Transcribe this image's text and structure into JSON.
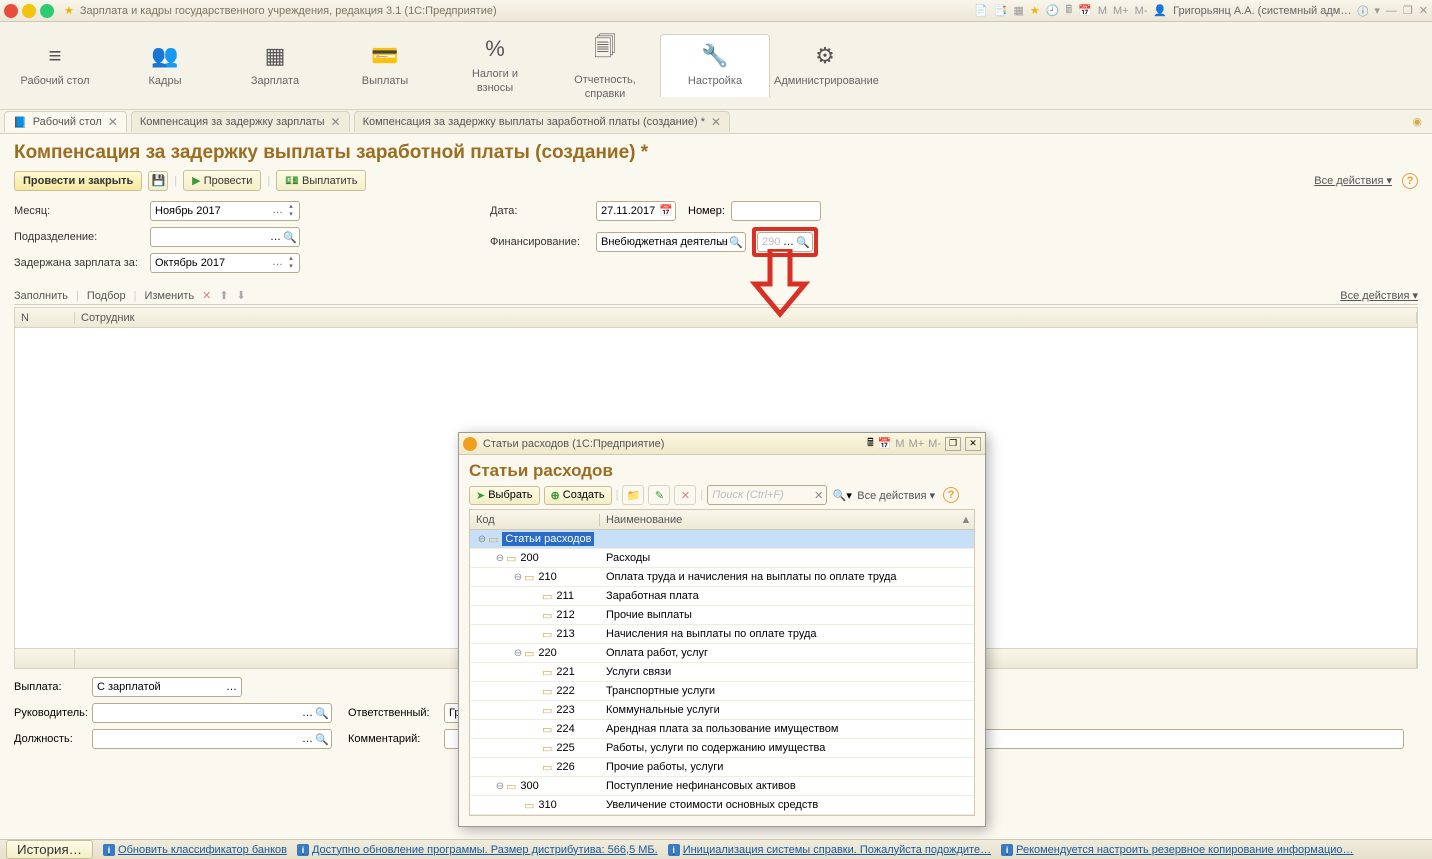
{
  "titlebar": {
    "title": "Зарплата и кадры государственного учреждения, редакция 3.1 (1С:Предприятие)",
    "m1": "M",
    "m2": "M+",
    "m3": "M-",
    "user": "Григорьянц А.А. (системный адм…"
  },
  "nav": [
    {
      "icon": "≡",
      "label": "Рабочий стол"
    },
    {
      "icon": "👥",
      "label": "Кадры"
    },
    {
      "icon": "▦",
      "label": "Зарплата"
    },
    {
      "icon": "💳",
      "label": "Выплаты"
    },
    {
      "icon": "%",
      "label": "Налоги и взносы"
    },
    {
      "icon": "🗐",
      "label": "Отчетность, справки"
    },
    {
      "icon": "🔧",
      "label": "Настройка"
    },
    {
      "icon": "⚙",
      "label": "Администрирование"
    }
  ],
  "tabs": {
    "t1": "Рабочий стол",
    "t2": "Компенсация за задержку зарплаты",
    "t3": "Компенсация за задержку выплаты заработной платы (создание) *"
  },
  "page": {
    "title": "Компенсация за задержку выплаты заработной платы (создание) *",
    "btn_post_close": "Провести и закрыть",
    "btn_post": "Провести",
    "btn_pay": "Выплатить",
    "all_actions": "Все действия ▾"
  },
  "form": {
    "month_lbl": "Месяц:",
    "month_val": "Ноябрь 2017",
    "dept_lbl": "Подразделение:",
    "dept_val": "",
    "delayed_lbl": "Задержана зарплата за:",
    "delayed_val": "Октябрь 2017",
    "date_lbl": "Дата:",
    "date_val": "27.11.2017",
    "num_lbl": "Номер:",
    "num_val": "",
    "fin_lbl": "Финансирование:",
    "fin_val": "Внебюджетная деятельн",
    "code_val": "290"
  },
  "subtoolbar": {
    "fill": "Заполнить",
    "pick": "Подбор",
    "edit": "Изменить",
    "all_actions": "Все действия ▾"
  },
  "table": {
    "col_n": "N",
    "col_emp": "Сотрудник"
  },
  "bottom": {
    "payout_lbl": "Выплата:",
    "payout_val": "С зарплатой",
    "head_lbl": "Руководитель:",
    "head_val": "",
    "resp_lbl": "Ответственный:",
    "resp_val": "Григорьянц А.А. (системный администрат",
    "pos_lbl": "Должность:",
    "pos_val": "",
    "comment_lbl": "Комментарий:",
    "comment_val": ""
  },
  "modal": {
    "wintitle": "Статьи расходов  (1С:Предприятие)",
    "m1": "M",
    "m2": "M+",
    "m3": "M-",
    "heading": "Статьи расходов",
    "btn_select": "Выбрать",
    "btn_create": "Создать",
    "search_ph": "Поиск (Ctrl+F)",
    "all_actions": "Все действия ▾",
    "col_code": "Код",
    "col_name": "Наименование",
    "rows": [
      {
        "indent": 0,
        "code": "",
        "name": "Статьи расходов",
        "sel": true,
        "toggle": "⊖"
      },
      {
        "indent": 1,
        "code": "200",
        "name": "Расходы",
        "toggle": "⊖"
      },
      {
        "indent": 2,
        "code": "210",
        "name": "Оплата труда и начисления на выплаты по оплате труда",
        "toggle": "⊖"
      },
      {
        "indent": 3,
        "code": "211",
        "name": "Заработная плата"
      },
      {
        "indent": 3,
        "code": "212",
        "name": "Прочие выплаты"
      },
      {
        "indent": 3,
        "code": "213",
        "name": "Начисления на выплаты по оплате труда"
      },
      {
        "indent": 2,
        "code": "220",
        "name": "Оплата работ, услуг",
        "toggle": "⊖"
      },
      {
        "indent": 3,
        "code": "221",
        "name": "Услуги связи"
      },
      {
        "indent": 3,
        "code": "222",
        "name": "Транспортные услуги"
      },
      {
        "indent": 3,
        "code": "223",
        "name": "Коммунальные услуги"
      },
      {
        "indent": 3,
        "code": "224",
        "name": "Арендная плата за пользование имуществом"
      },
      {
        "indent": 3,
        "code": "225",
        "name": "Работы, услуги по содержанию имущества"
      },
      {
        "indent": 3,
        "code": "226",
        "name": "Прочие работы, услуги"
      },
      {
        "indent": 1,
        "code": "300",
        "name": "Поступление нефинансовых активов",
        "toggle": "⊖"
      },
      {
        "indent": 2,
        "code": "310",
        "name": "Увеличение стоимости основных средств"
      }
    ]
  },
  "status": {
    "history": "История…",
    "s1": "Обновить классификатор банков",
    "s2": "Доступно обновление программы. Размер дистрибутива: 566,5 МБ.",
    "s3": "Инициализация системы справки. Пожалуйста подождите…",
    "s4": "Рекомендуется настроить резервное копирование информацио…"
  }
}
